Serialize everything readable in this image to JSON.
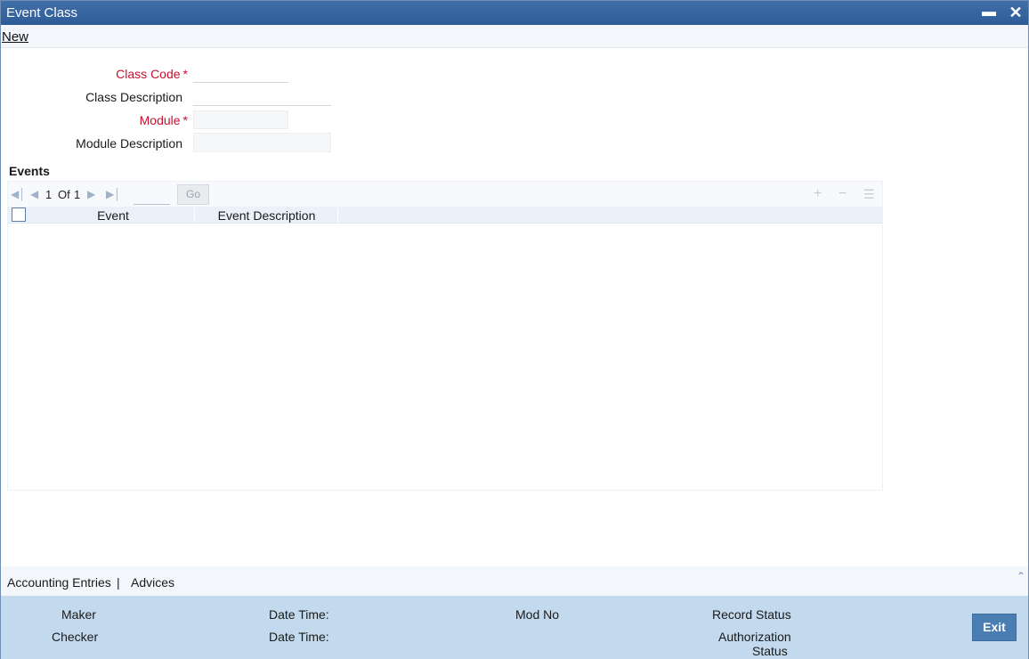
{
  "window": {
    "title": "Event Class"
  },
  "menu": {
    "new_label": "New"
  },
  "form": {
    "class_code_label": "Class Code",
    "class_description_label": "Class Description",
    "module_label": "Module",
    "module_description_label": "Module Description",
    "required_marker": "*",
    "class_code_value": "",
    "class_description_value": "",
    "module_value": "",
    "module_description_value": ""
  },
  "events": {
    "section_title": "Events",
    "pager": {
      "current": "1",
      "of_label": "Of",
      "total": "1",
      "go_label": "Go",
      "page_input": ""
    },
    "columns": [
      "Event",
      "Event Description"
    ],
    "rows": []
  },
  "tabs": {
    "items": [
      "Accounting Entries",
      "Advices"
    ],
    "separator": "|"
  },
  "footer": {
    "maker_label": "Maker",
    "checker_label": "Checker",
    "date_time_label": "Date Time:",
    "mod_no_label": "Mod No",
    "record_status_label": "Record Status",
    "authorization_label": "Authorization",
    "status_label": "Status",
    "exit_label": "Exit"
  },
  "icons": {
    "first_page": "first-page-icon",
    "prev_page": "prev-page-icon",
    "next_page": "next-page-icon",
    "last_page": "last-page-icon",
    "add_row": "add-row-icon",
    "delete_row": "delete-row-icon",
    "view_details": "single-view-icon",
    "minimize": "minimize-icon",
    "close": "close-icon",
    "collapse": "chevron-up-icon"
  },
  "colors": {
    "title_bar": "#2f5c96",
    "required": "#c8102e",
    "footer_bg": "#c3d9ed",
    "exit_button": "#4a7eb3"
  }
}
